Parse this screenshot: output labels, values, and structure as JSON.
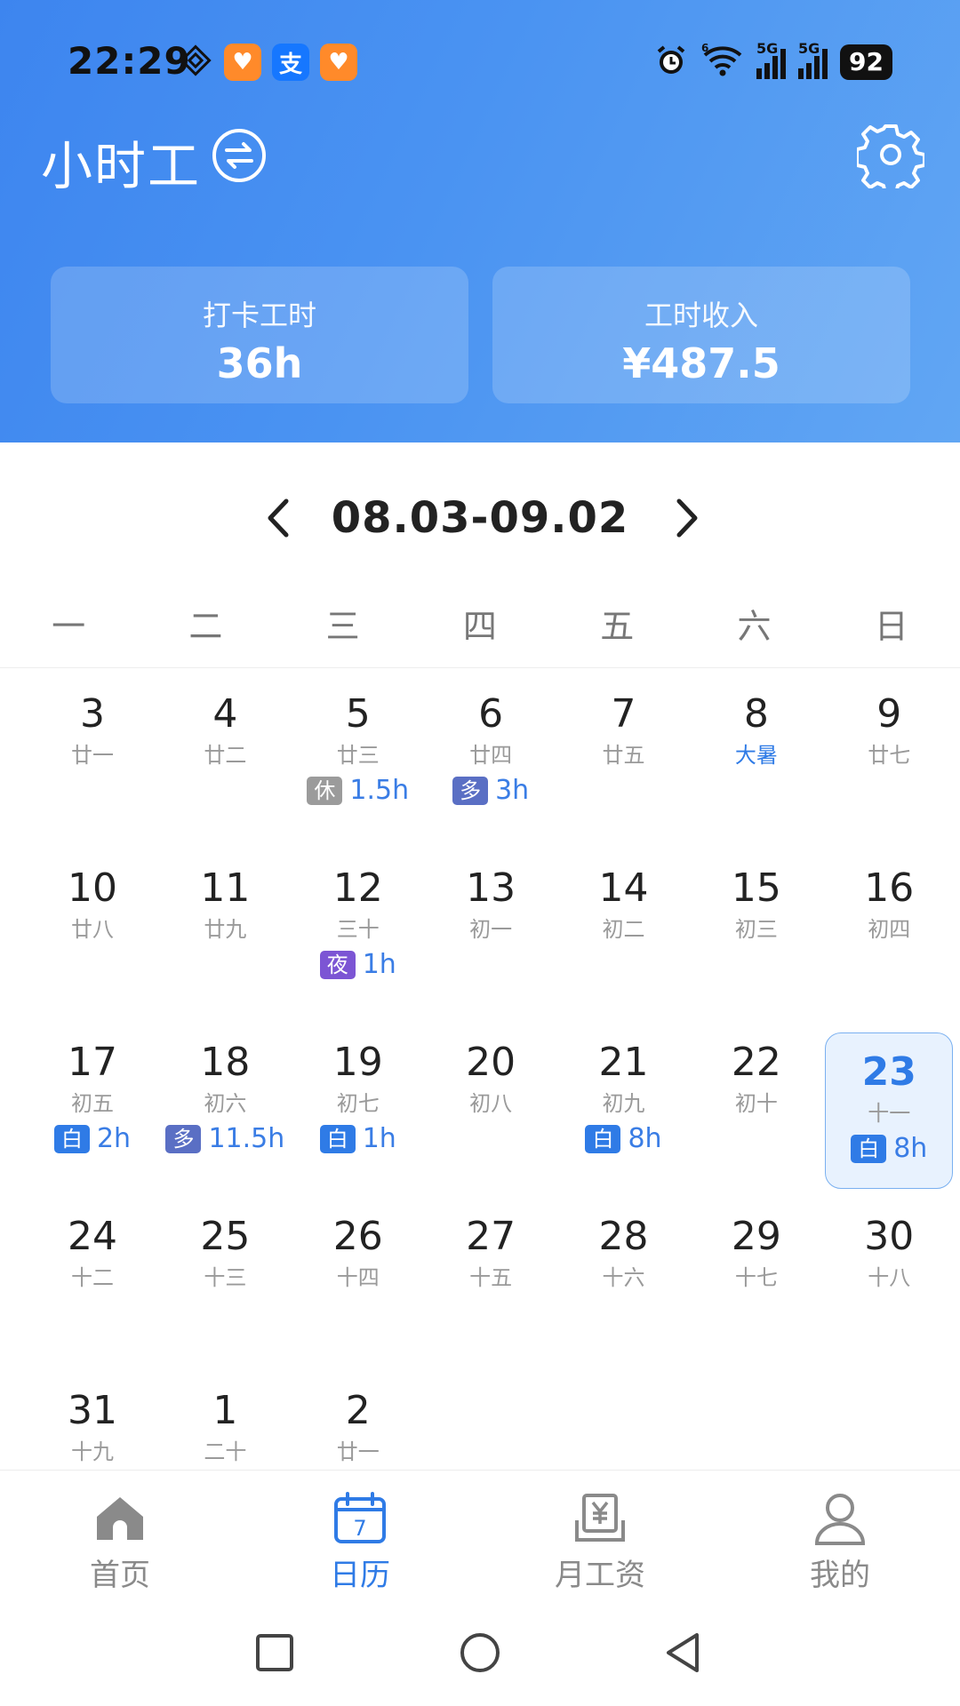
{
  "status": {
    "time": "22:29",
    "battery": "92",
    "sig_label": "5G",
    "wifi_sup": "6"
  },
  "header": {
    "title": "小时工"
  },
  "summary": [
    {
      "label": "打卡工时",
      "value": "36h"
    },
    {
      "label": "工时收入",
      "value": "¥487.5"
    }
  ],
  "range": {
    "text": "08.03-09.02"
  },
  "weekdays": [
    "一",
    "二",
    "三",
    "四",
    "五",
    "六",
    "日"
  ],
  "calendar": [
    {
      "day": "3",
      "lunar": "廿一"
    },
    {
      "day": "4",
      "lunar": "廿二"
    },
    {
      "day": "5",
      "lunar": "廿三",
      "badge": "休",
      "badge_color": "#9b9b9b",
      "hours": "1.5h"
    },
    {
      "day": "6",
      "lunar": "廿四",
      "badge": "多",
      "badge_color": "#5a6fc4",
      "hours": "3h"
    },
    {
      "day": "7",
      "lunar": "廿五"
    },
    {
      "day": "8",
      "lunar": "大暑",
      "term": true
    },
    {
      "day": "9",
      "lunar": "廿七"
    },
    {
      "day": "10",
      "lunar": "廿八"
    },
    {
      "day": "11",
      "lunar": "廿九"
    },
    {
      "day": "12",
      "lunar": "三十",
      "badge": "夜",
      "badge_color": "#7c55d4",
      "hours": "1h"
    },
    {
      "day": "13",
      "lunar": "初一"
    },
    {
      "day": "14",
      "lunar": "初二"
    },
    {
      "day": "15",
      "lunar": "初三"
    },
    {
      "day": "16",
      "lunar": "初四"
    },
    {
      "day": "17",
      "lunar": "初五",
      "badge": "白",
      "badge_color": "#2f7be6",
      "hours": "2h"
    },
    {
      "day": "18",
      "lunar": "初六",
      "badge": "多",
      "badge_color": "#5a6fc4",
      "hours": "11.5h"
    },
    {
      "day": "19",
      "lunar": "初七",
      "badge": "白",
      "badge_color": "#2f7be6",
      "hours": "1h"
    },
    {
      "day": "20",
      "lunar": "初八"
    },
    {
      "day": "21",
      "lunar": "初九",
      "badge": "白",
      "badge_color": "#2f7be6",
      "hours": "8h"
    },
    {
      "day": "22",
      "lunar": "初十"
    },
    {
      "day": "23",
      "lunar": "十一",
      "badge": "白",
      "badge_color": "#2f7be6",
      "hours": "8h",
      "today": true
    },
    {
      "day": "24",
      "lunar": "十二"
    },
    {
      "day": "25",
      "lunar": "十三"
    },
    {
      "day": "26",
      "lunar": "十四"
    },
    {
      "day": "27",
      "lunar": "十五"
    },
    {
      "day": "28",
      "lunar": "十六"
    },
    {
      "day": "29",
      "lunar": "十七"
    },
    {
      "day": "30",
      "lunar": "十八"
    },
    {
      "day": "31",
      "lunar": "十九"
    },
    {
      "day": "1",
      "lunar": "二十"
    },
    {
      "day": "2",
      "lunar": "廿一"
    }
  ],
  "nav": [
    {
      "label": "首页",
      "icon": "home-icon"
    },
    {
      "label": "日历",
      "icon": "calendar-icon",
      "active": true,
      "calendar_num": "7"
    },
    {
      "label": "月工资",
      "icon": "salary-icon"
    },
    {
      "label": "我的",
      "icon": "profile-icon"
    }
  ],
  "colors": {
    "accent": "#2f7be6",
    "header_start": "#3d85ef",
    "header_end": "#61a6f3"
  }
}
